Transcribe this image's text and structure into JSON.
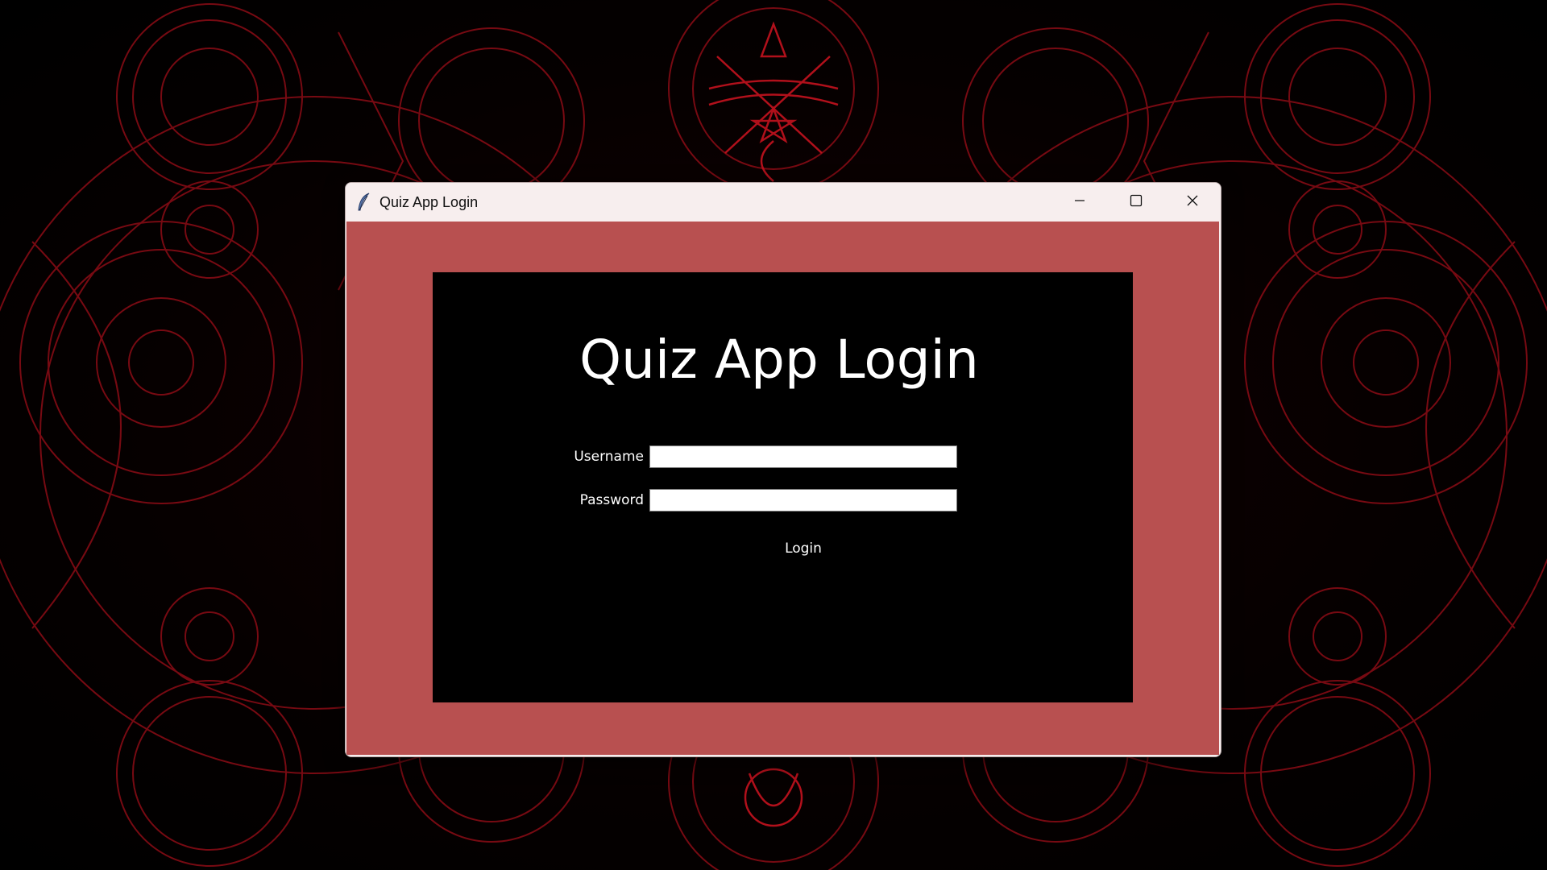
{
  "window": {
    "title": "Quiz App Login",
    "icon": "feather-icon"
  },
  "caption_buttons": {
    "minimize": "minimize-icon",
    "maximize": "maximize-icon",
    "close": "close-icon"
  },
  "login_form": {
    "heading": "Quiz App Login",
    "username_label": "Username",
    "username_value": "",
    "password_label": "Password",
    "password_value": "",
    "login_button": "Login"
  },
  "colors": {
    "client_background": "#b85050",
    "panel_background": "#000000",
    "titlebar_background": "#f7eeee",
    "wallpaper_accent": "#b0101a"
  }
}
